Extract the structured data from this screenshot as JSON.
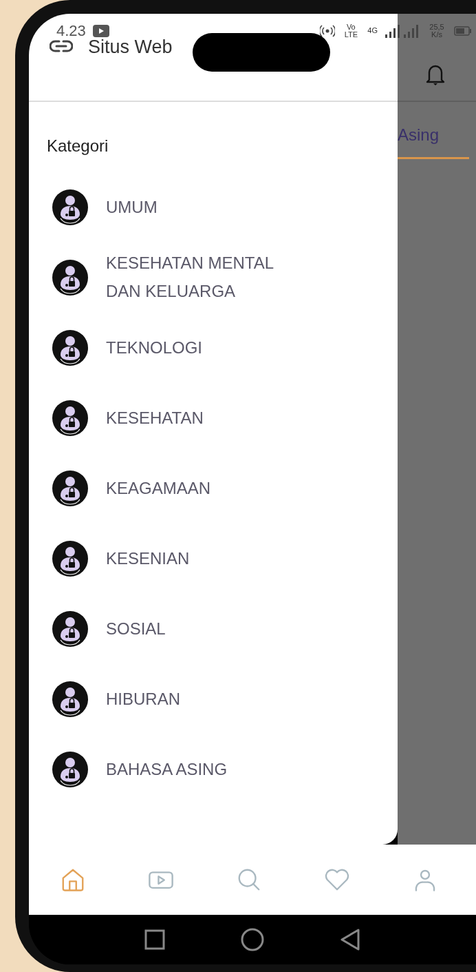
{
  "status_bar": {
    "time": "4.23",
    "network_label": "Vo LTE",
    "data_type": "4G",
    "speed": "25,5 K/s"
  },
  "header": {
    "title": "Situs Web"
  },
  "drawer": {
    "heading": "Kategori",
    "items": [
      {
        "label": "UMUM"
      },
      {
        "label": "KESEHATAN MENTAL DAN KELUARGA"
      },
      {
        "label": "TEKNOLOGI"
      },
      {
        "label": "KESEHATAN"
      },
      {
        "label": "KEAGAMAAN"
      },
      {
        "label": "KESENIAN"
      },
      {
        "label": "SOSIAL"
      },
      {
        "label": "HIBURAN"
      },
      {
        "label": "BAHASA ASING"
      }
    ]
  },
  "background_page": {
    "tab_label": "Asing"
  },
  "bottom_nav": [
    {
      "kind": "home",
      "selected": true
    },
    {
      "kind": "video",
      "selected": false
    },
    {
      "kind": "search",
      "selected": false
    },
    {
      "kind": "favorite",
      "selected": false
    },
    {
      "kind": "profile",
      "selected": false
    }
  ]
}
